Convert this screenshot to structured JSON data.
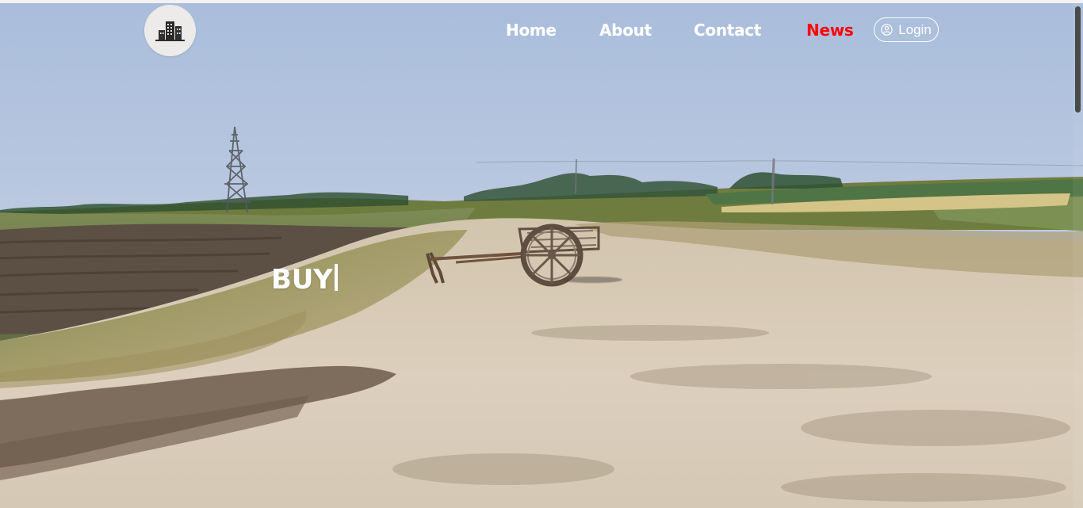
{
  "nav": {
    "links": {
      "home": "Home",
      "about": "About",
      "contact": "Contact",
      "news": "News"
    },
    "login": "Login",
    "active_color": "#ff0000"
  },
  "hero": {
    "headline": "BUY"
  },
  "icons": {
    "logo": "building-logo-icon",
    "login": "user-circle-icon",
    "background": "rural-land-photo-icon"
  },
  "colors": {
    "nav_text": "#ffffff",
    "news": "#ff0000",
    "logo_background": "#ecebea",
    "sky": "#aebfda",
    "ground": "#d8cfbf"
  }
}
